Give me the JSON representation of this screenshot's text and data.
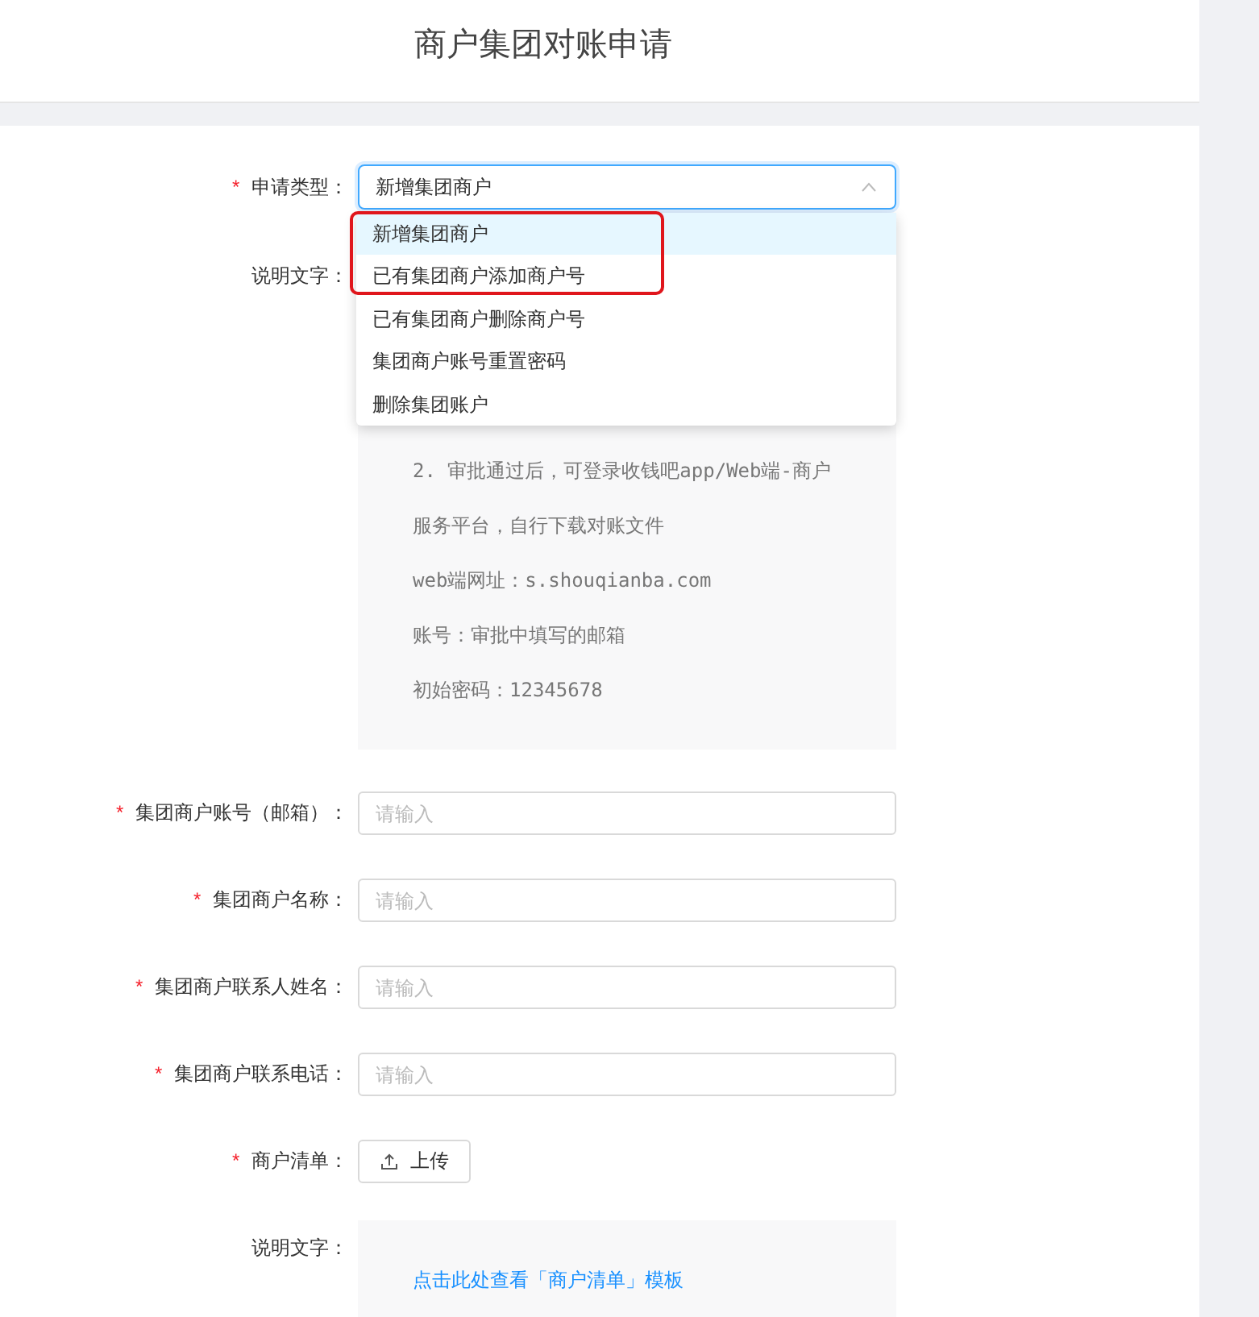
{
  "header": {
    "title": "商户集团对账申请"
  },
  "form": {
    "type_field": {
      "required_mark": "*",
      "label": "申请类型：",
      "value": "新增集团商户",
      "expanded": true,
      "options": [
        {
          "label": "新增集团商户",
          "selected": true
        },
        {
          "label": "已有集团商户添加商户号",
          "selected": false
        },
        {
          "label": "已有集团商户删除商户号",
          "selected": false
        },
        {
          "label": "集团商户账号重置密码",
          "selected": false
        },
        {
          "label": "删除集团账户",
          "selected": false
        }
      ]
    },
    "note": {
      "label": "说明文字：",
      "lines": [
        "2. 审批通过后，可登录收钱吧app/Web端-商户",
        "服务平台，自行下载对账文件",
        "web端网址：s.shouqianba.com",
        "账号：审批中填写的邮箱",
        "初始密码：12345678"
      ]
    },
    "fields": [
      {
        "required_mark": "*",
        "label": "集团商户账号（邮箱）：",
        "placeholder": "请输入"
      },
      {
        "required_mark": "*",
        "label": "集团商户名称：",
        "placeholder": "请输入"
      },
      {
        "required_mark": "*",
        "label": "集团商户联系人姓名：",
        "placeholder": "请输入"
      },
      {
        "required_mark": "*",
        "label": "集团商户联系电话：",
        "placeholder": "请输入"
      }
    ],
    "upload": {
      "required_mark": "*",
      "label": "商户清单：",
      "button": "上传"
    },
    "template_note": {
      "label": "说明文字：",
      "link": "点击此处查看「商户清单」模板"
    }
  }
}
